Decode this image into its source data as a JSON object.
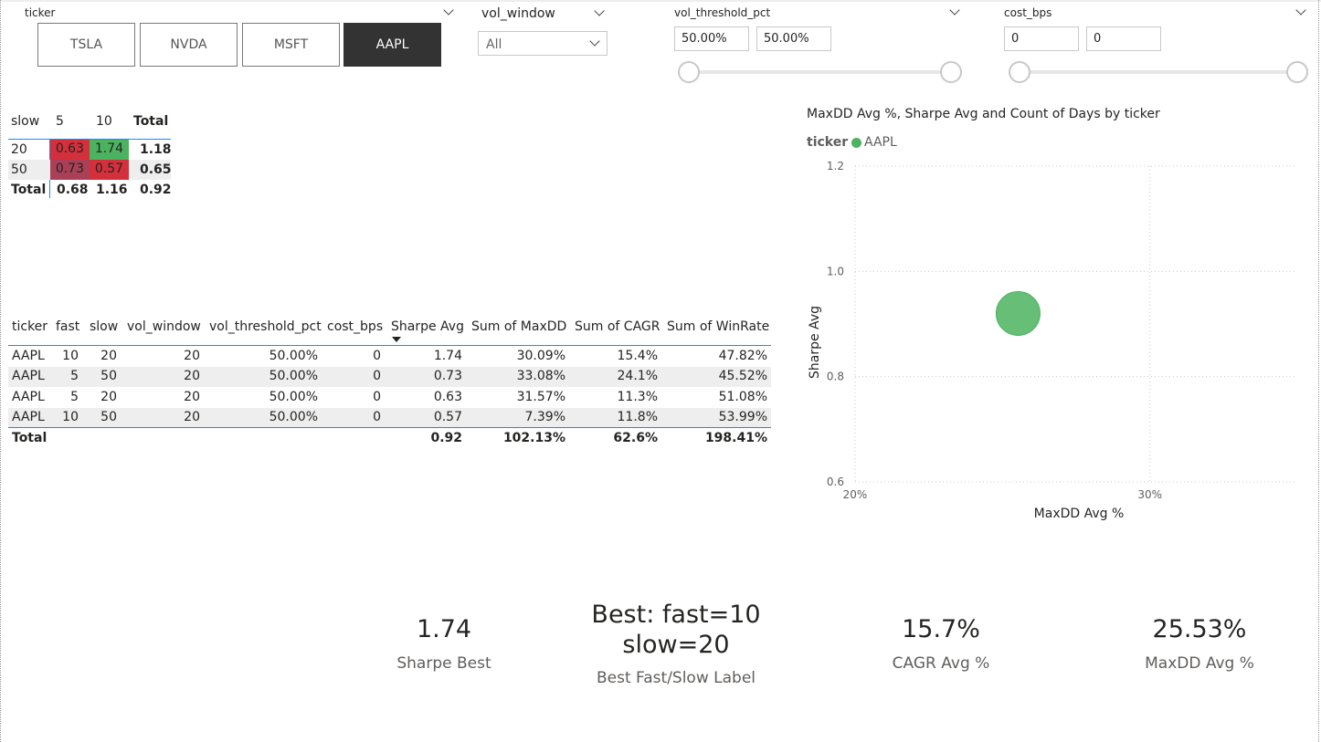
{
  "slicers": {
    "ticker": {
      "title": "ticker",
      "options": [
        "TSLA",
        "NVDA",
        "MSFT",
        "AAPL"
      ],
      "selected": "AAPL"
    },
    "vol_window": {
      "title": "vol_window",
      "value": "All"
    },
    "vol_threshold_pct": {
      "title": "vol_threshold_pct",
      "min": "50.00%",
      "max": "50.00%"
    },
    "cost_bps": {
      "title": "cost_bps",
      "min": "0",
      "max": "0"
    }
  },
  "matrix": {
    "row_header": "slow",
    "columns": [
      "5",
      "10",
      "Total"
    ],
    "rows": [
      {
        "label": "20",
        "values": [
          "0.63",
          "1.74"
        ],
        "total": "1.18"
      },
      {
        "label": "50",
        "values": [
          "0.73",
          "0.57"
        ],
        "total": "0.65"
      }
    ],
    "total_row": {
      "label": "Total",
      "values": [
        "0.68",
        "1.16"
      ],
      "total": "0.92"
    },
    "colors": {
      "low": "#d4303c",
      "mid": "#a94058",
      "high": "#4bb35f"
    }
  },
  "table": {
    "columns": [
      "ticker",
      "fast",
      "slow",
      "vol_window",
      "vol_threshold_pct",
      "cost_bps",
      "Sharpe Avg",
      "Sum of MaxDD",
      "Sum of CAGR",
      "Sum of WinRate"
    ],
    "sort_column": "Sharpe Avg",
    "rows": [
      [
        "AAPL",
        "10",
        "20",
        "20",
        "50.00%",
        "0",
        "1.74",
        "30.09%",
        "15.4%",
        "47.82%"
      ],
      [
        "AAPL",
        "5",
        "50",
        "20",
        "50.00%",
        "0",
        "0.73",
        "33.08%",
        "24.1%",
        "45.52%"
      ],
      [
        "AAPL",
        "5",
        "20",
        "20",
        "50.00%",
        "0",
        "0.63",
        "31.57%",
        "11.3%",
        "51.08%"
      ],
      [
        "AAPL",
        "10",
        "50",
        "20",
        "50.00%",
        "0",
        "0.57",
        "7.39%",
        "11.8%",
        "53.99%"
      ]
    ],
    "total": [
      "Total",
      "",
      "",
      "",
      "",
      "",
      "0.92",
      "102.13%",
      "62.6%",
      "198.41%"
    ]
  },
  "chart_data": {
    "type": "scatter",
    "title": "MaxDD Avg %, Sharpe Avg and Count of Days by ticker",
    "legend_title": "ticker",
    "legend_position": "top-left",
    "xlabel": "MaxDD Avg %",
    "ylabel": "Sharpe Avg",
    "xlim": [
      20,
      35
    ],
    "ylim": [
      0.6,
      1.2
    ],
    "x_ticks": [
      "20%",
      "30%"
    ],
    "y_ticks": [
      "0.6",
      "0.8",
      "1.0",
      "1.2"
    ],
    "grid": true,
    "series": [
      {
        "name": "AAPL",
        "color": "#4bb35f",
        "points": [
          {
            "x": 25.53,
            "y": 0.92
          }
        ]
      }
    ]
  },
  "cards": [
    {
      "value": "1.74",
      "label": "Sharpe Best"
    },
    {
      "value_line1": "Best: fast=10",
      "value_line2": "slow=20",
      "label": "Best Fast/Slow Label"
    },
    {
      "value": "15.7%",
      "label": "CAGR Avg %"
    },
    {
      "value": "25.53%",
      "label": "MaxDD Avg %"
    }
  ]
}
